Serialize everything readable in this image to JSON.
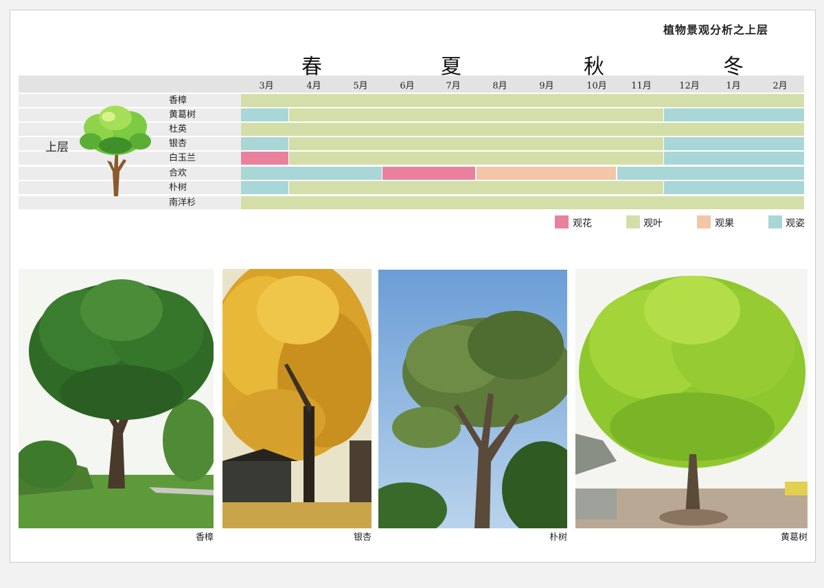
{
  "title": "植物景观分析之上层",
  "seasons": [
    "春",
    "夏",
    "秋",
    "冬"
  ],
  "months": [
    "3月",
    "4月",
    "5月",
    "6月",
    "7月",
    "8月",
    "9月",
    "10月",
    "11月",
    "12月",
    "1月",
    "2月"
  ],
  "layer_label": "上层",
  "plants": [
    {
      "name": "香樟"
    },
    {
      "name": "黄葛树"
    },
    {
      "name": "杜英"
    },
    {
      "name": "银杏"
    },
    {
      "name": "白玉兰"
    },
    {
      "name": "合欢"
    },
    {
      "name": "朴树"
    },
    {
      "name": "南洋杉"
    }
  ],
  "legend": [
    {
      "label": "观花",
      "color": "#e9819e"
    },
    {
      "label": "观叶",
      "color": "#d4dea9"
    },
    {
      "label": "观果",
      "color": "#f2c6a6"
    },
    {
      "label": "观姿",
      "color": "#a9d6d6"
    }
  ],
  "photos": [
    {
      "caption": "香樟"
    },
    {
      "caption": "银杏"
    },
    {
      "caption": "朴树"
    },
    {
      "caption": "黄葛树"
    }
  ]
}
